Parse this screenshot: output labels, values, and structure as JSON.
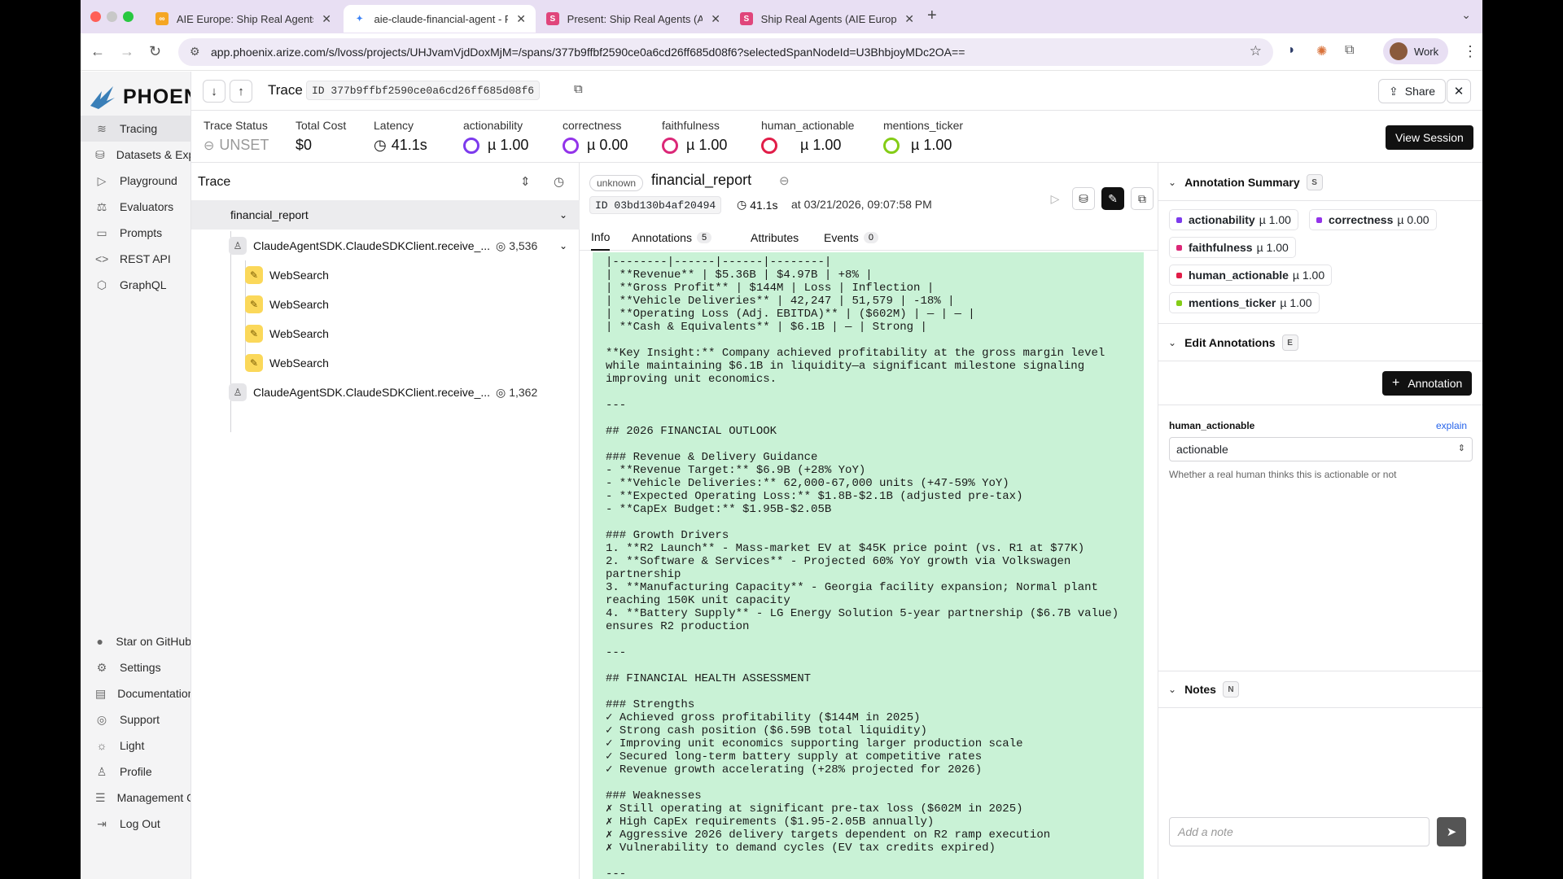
{
  "browser": {
    "tabs": [
      {
        "label": "AIE Europe: Ship Real Agents",
        "favicon": "glasses-icon",
        "color": "#f5a623"
      },
      {
        "label": "aie-claude-financial-agent - P",
        "favicon": "phoenix-icon",
        "color": "#3b82f6"
      },
      {
        "label": "Present: Ship Real Agents (AIE",
        "favicon": "S",
        "color": "#e0457b"
      },
      {
        "label": "Ship Real Agents (AIE Europe)",
        "favicon": "S",
        "color": "#e0457b"
      }
    ],
    "url": "app.phoenix.arize.com/s/lvoss/projects/UHJvamVjdDoxMjM=/spans/377b9ffbf2590ce0a6cd26ff685d08f6?selectedSpanNodeId=U3BhbjoyMDc2OA==",
    "profile": "Work"
  },
  "sidebar": {
    "logo": "PHOENIX",
    "items": [
      {
        "label": "Tracing",
        "icon": "tracing-icon"
      },
      {
        "label": "Datasets & Experiments",
        "icon": "database-icon"
      },
      {
        "label": "Playground",
        "icon": "playground-icon"
      },
      {
        "label": "Evaluators",
        "icon": "evaluators-icon"
      },
      {
        "label": "Prompts",
        "icon": "prompts-icon"
      },
      {
        "label": "REST API",
        "icon": "code-icon"
      },
      {
        "label": "GraphQL",
        "icon": "graphql-icon"
      }
    ],
    "bottom_items": [
      {
        "label": "Star on GitHub",
        "icon": "github-icon"
      },
      {
        "label": "Settings",
        "icon": "gear-icon"
      },
      {
        "label": "Documentation",
        "icon": "book-icon"
      },
      {
        "label": "Support",
        "icon": "support-icon"
      },
      {
        "label": "Light",
        "icon": "sun-icon"
      },
      {
        "label": "Profile",
        "icon": "user-icon"
      },
      {
        "label": "Management Console",
        "icon": "server-icon"
      },
      {
        "label": "Log Out",
        "icon": "logout-icon"
      }
    ]
  },
  "trace_header": {
    "title": "Trace",
    "id": "ID 377b9ffbf2590ce0a6cd26ff685d08f6",
    "share_label": "Share"
  },
  "metrics": {
    "trace_status": {
      "label": "Trace Status",
      "value": "UNSET"
    },
    "total_cost": {
      "label": "Total Cost",
      "value": "$0"
    },
    "latency": {
      "label": "Latency",
      "value": "41.1s"
    },
    "actionability": {
      "label": "actionability",
      "value": "µ 1.00",
      "color": "#7c3aed"
    },
    "correctness": {
      "label": "correctness",
      "value": "µ 0.00",
      "color": "#9333ea"
    },
    "faithfulness": {
      "label": "faithfulness",
      "value": "µ 1.00",
      "color": "#db2777"
    },
    "human_actionable": {
      "label": "human_actionable",
      "value": "µ 1.00",
      "color": "#e11d48"
    },
    "mentions_ticker": {
      "label": "mentions_ticker",
      "value": "µ 1.00",
      "color": "#84cc16"
    },
    "view_session_label": "View Session"
  },
  "tree": {
    "title": "Trace",
    "root": "financial_report",
    "client1": {
      "label": "ClaudeAgentSDK.ClaudeSDKClient.receive_...",
      "tokens": "3,536"
    },
    "websearch": [
      "WebSearch",
      "WebSearch",
      "WebSearch",
      "WebSearch"
    ],
    "client2": {
      "label": "ClaudeAgentSDK.ClaudeSDKClient.receive_...",
      "tokens": "1,362"
    }
  },
  "span": {
    "kind": "unknown",
    "name": "financial_report",
    "id": "ID 03bd130b4af20494",
    "latency": "41.1s",
    "time": "at 03/21/2026, 09:07:58 PM",
    "tabs": {
      "info": "Info",
      "annotations": "Annotations",
      "annotations_count": "5",
      "attributes": "Attributes",
      "events": "Events",
      "events_count": "0"
    },
    "report": "|--------|------|------|--------|\n| **Revenue** | $5.36B | $4.97B | +8% |\n| **Gross Profit** | $144M | Loss | Inflection |\n| **Vehicle Deliveries** | 42,247 | 51,579 | -18% |\n| **Operating Loss (Adj. EBITDA)** | ($602M) | — | — |\n| **Cash & Equivalents** | $6.1B | — | Strong |\n\n**Key Insight:** Company achieved profitability at the gross margin level\nwhile maintaining $6.1B in liquidity—a significant milestone signaling\nimproving unit economics.\n\n---\n\n## 2026 FINANCIAL OUTLOOK\n\n### Revenue & Delivery Guidance\n- **Revenue Target:** $6.9B (+28% YoY)\n- **Vehicle Deliveries:** 62,000-67,000 units (+47-59% YoY)\n- **Expected Operating Loss:** $1.8B-$2.1B (adjusted pre-tax)\n- **CapEx Budget:** $1.95B-$2.05B\n\n### Growth Drivers\n1. **R2 Launch** - Mass-market EV at $45K price point (vs. R1 at $77K)\n2. **Software & Services** - Projected 60% YoY growth via Volkswagen\npartnership\n3. **Manufacturing Capacity** - Georgia facility expansion; Normal plant\nreaching 150K unit capacity\n4. **Battery Supply** - LG Energy Solution 5-year partnership ($6.7B value)\nensures R2 production\n\n---\n\n## FINANCIAL HEALTH ASSESSMENT\n\n### Strengths\n✓ Achieved gross profitability ($144M in 2025)\n✓ Strong cash position ($6.59B total liquidity)\n✓ Improving unit economics supporting larger production scale\n✓ Secured long-term battery supply at competitive rates\n✓ Revenue growth accelerating (+28% projected for 2026)\n\n### Weaknesses\n✗ Still operating at significant pre-tax loss ($602M in 2025)\n✗ High CapEx requirements ($1.95-2.05B annually)\n✗ Aggressive 2026 delivery targets dependent on R2 ramp execution\n✗ Vulnerability to demand cycles (EV tax credits expired)\n\n---"
  },
  "annotations": {
    "summary_title": "Annotation Summary",
    "summary_key": "S",
    "chips": [
      {
        "name": "actionability",
        "value": "µ 1.00",
        "color": "#7c3aed"
      },
      {
        "name": "correctness",
        "value": "µ 0.00",
        "color": "#9333ea"
      },
      {
        "name": "faithfulness",
        "value": "µ 1.00",
        "color": "#db2777"
      },
      {
        "name": "human_actionable",
        "value": "µ 1.00",
        "color": "#e11d48"
      },
      {
        "name": "mentions_ticker",
        "value": "µ 1.00",
        "color": "#84cc16"
      }
    ],
    "edit_title": "Edit Annotations",
    "edit_key": "E",
    "add_label": "Annotation",
    "field_label": "human_actionable",
    "explain_label": "explain",
    "field_value": "actionable",
    "field_help": "Whether a real human thinks this is actionable or not",
    "notes_title": "Notes",
    "notes_key": "N",
    "note_placeholder": "Add a note"
  }
}
